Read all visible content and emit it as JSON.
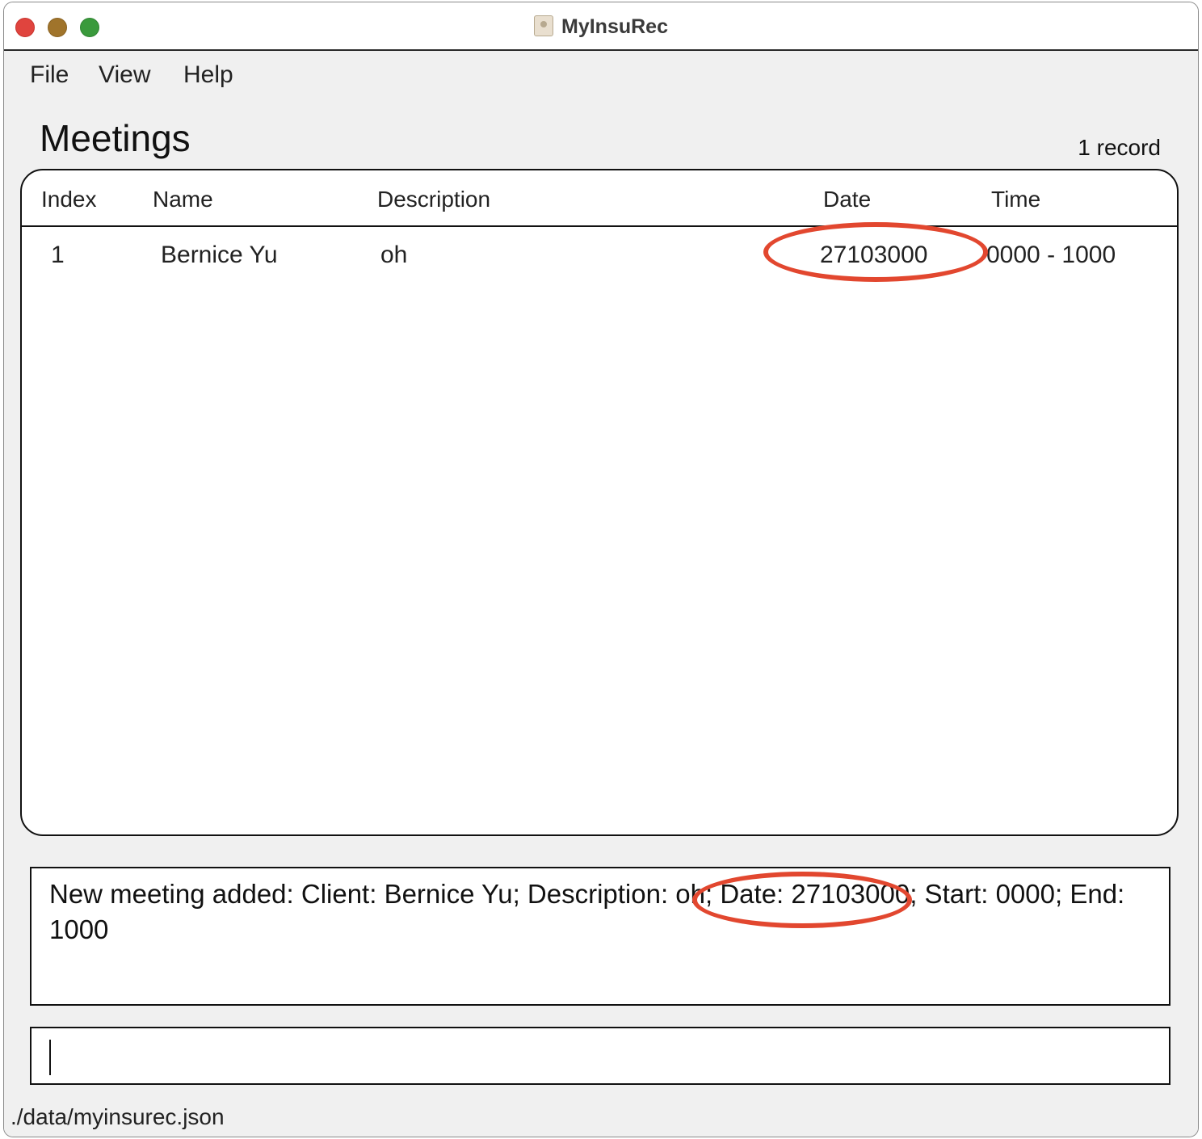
{
  "window": {
    "title": "MyInsuRec"
  },
  "menu": {
    "items": [
      "File",
      "View",
      "Help"
    ]
  },
  "meetings": {
    "title": "Meetings",
    "record_count": "1 record",
    "columns": [
      "Index",
      "Name",
      "Description",
      "Date",
      "Time"
    ],
    "rows": [
      {
        "index": "1",
        "name": "Bernice Yu",
        "description": "oh",
        "date": "27103000",
        "time": "0000 - 1000"
      }
    ]
  },
  "result": {
    "message": "New meeting added: Client: Bernice Yu; Description: oh; Date: 27103000; Start: 0000; End: 1000"
  },
  "command": {
    "value": ""
  },
  "status": {
    "file_path": "./data/myinsurec.json"
  },
  "annotation_color": "#e2472f"
}
